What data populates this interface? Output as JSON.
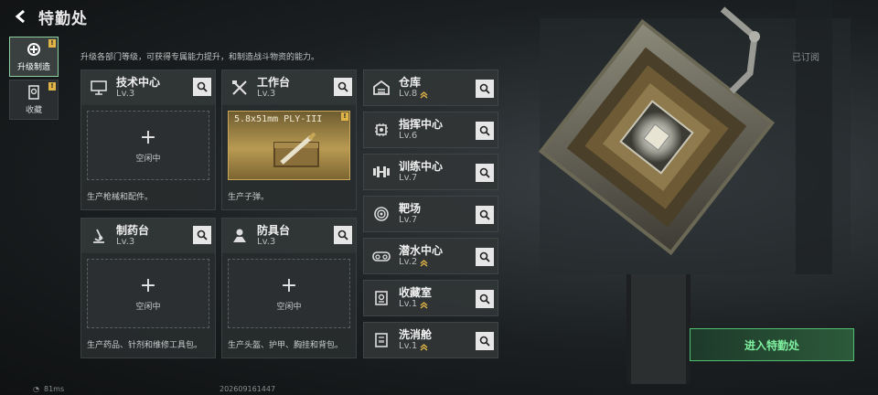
{
  "header": {
    "title": "特勤处"
  },
  "sidebar": [
    {
      "label": "升级制造",
      "active": true,
      "icon": "upgrade-icon",
      "alert": "!"
    },
    {
      "label": "收藏",
      "active": false,
      "icon": "collection-icon",
      "alert": "!"
    }
  ],
  "description": "升级各部门等级，可获得专属能力提升，和制造战斗物资的能力。",
  "panels": {
    "tech": {
      "name": "技术中心",
      "level": "Lv.3",
      "slot": "空闲中",
      "footer": "生产枪械和配件。",
      "icon": "computer-icon"
    },
    "workbench": {
      "name": "工作台",
      "level": "Lv.3",
      "item": "5.8x51mm PLY-III",
      "item_alert": "!",
      "footer": "生产子弹。",
      "icon": "hammer-wrench-icon"
    },
    "pharmacy": {
      "name": "制药台",
      "level": "Lv.3",
      "slot": "空闲中",
      "footer": "生产药品、针剂和维修工具包。",
      "icon": "microscope-icon"
    },
    "armor": {
      "name": "防具台",
      "level": "Lv.3",
      "slot": "空闲中",
      "footer": "生产头盔、护甲、胸挂和背包。",
      "icon": "armor-icon"
    }
  },
  "right_list": [
    {
      "name": "仓库",
      "level": "Lv.8",
      "upgradable": true,
      "icon": "warehouse-icon"
    },
    {
      "name": "指挥中心",
      "level": "Lv.6",
      "upgradable": false,
      "icon": "command-chip-icon"
    },
    {
      "name": "训练中心",
      "level": "Lv.7",
      "upgradable": false,
      "icon": "dumbbell-icon"
    },
    {
      "name": "靶场",
      "level": "Lv.7",
      "upgradable": false,
      "icon": "target-icon"
    },
    {
      "name": "潜水中心",
      "level": "Lv.2",
      "upgradable": true,
      "icon": "diving-mask-icon"
    },
    {
      "name": "收藏室",
      "level": "Lv.1",
      "upgradable": true,
      "icon": "vault-icon"
    },
    {
      "name": "洗消舱",
      "level": "Lv.1",
      "upgradable": true,
      "icon": "shower-icon"
    }
  ],
  "subscribed": "已订阅",
  "enter_button": "进入特勤处",
  "status": {
    "ping": "81ms",
    "id": "202609161447"
  },
  "colors": {
    "accent_green": "#4fbf70",
    "alert_yellow": "#e0b547",
    "gold_item": "#b89a52"
  }
}
